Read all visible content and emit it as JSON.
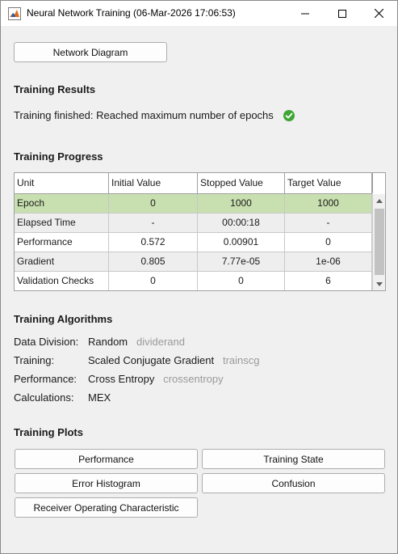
{
  "window": {
    "title": "Neural Network Training (06-Mar-2026 17:06:53)"
  },
  "network_diagram_button": "Network Diagram",
  "results": {
    "heading": "Training Results",
    "status": "Training finished: Reached maximum number of epochs"
  },
  "progress": {
    "heading": "Training Progress",
    "columns": [
      "Unit",
      "Initial Value",
      "Stopped Value",
      "Target Value"
    ],
    "rows": [
      [
        "Epoch",
        "0",
        "1000",
        "1000"
      ],
      [
        "Elapsed Time",
        "-",
        "00:00:18",
        "-"
      ],
      [
        "Performance",
        "0.572",
        "0.00901",
        "0"
      ],
      [
        "Gradient",
        "0.805",
        "7.77e-05",
        "1e-06"
      ],
      [
        "Validation Checks",
        "0",
        "0",
        "6"
      ]
    ]
  },
  "algorithms": {
    "heading": "Training Algorithms",
    "items": [
      {
        "label": "Data Division:",
        "value": "Random",
        "func": "dividerand"
      },
      {
        "label": "Training:",
        "value": "Scaled Conjugate Gradient",
        "func": "trainscg"
      },
      {
        "label": "Performance:",
        "value": "Cross Entropy",
        "func": "crossentropy"
      },
      {
        "label": "Calculations:",
        "value": "MEX",
        "func": ""
      }
    ]
  },
  "plots": {
    "heading": "Training Plots",
    "buttons": [
      "Performance",
      "Training State",
      "Error Histogram",
      "Confusion",
      "Receiver Operating Characteristic"
    ]
  },
  "colors": {
    "selected_row": "#c8e0b0",
    "check_green": "#3fa535"
  }
}
